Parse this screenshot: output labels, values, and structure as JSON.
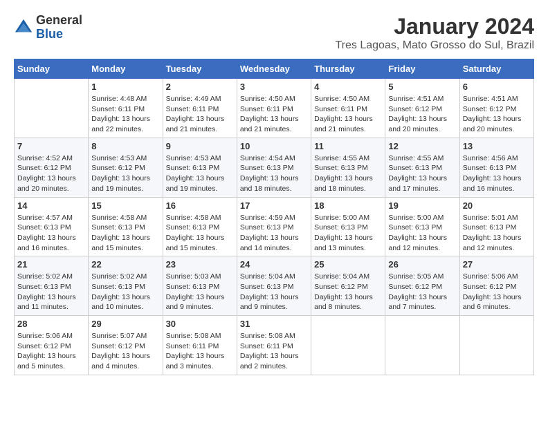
{
  "header": {
    "logo_general": "General",
    "logo_blue": "Blue",
    "month_year": "January 2024",
    "location": "Tres Lagoas, Mato Grosso do Sul, Brazil"
  },
  "weekdays": [
    "Sunday",
    "Monday",
    "Tuesday",
    "Wednesday",
    "Thursday",
    "Friday",
    "Saturday"
  ],
  "weeks": [
    [
      {
        "day": "",
        "sunrise": "",
        "sunset": "",
        "daylight": ""
      },
      {
        "day": "1",
        "sunrise": "Sunrise: 4:48 AM",
        "sunset": "Sunset: 6:11 PM",
        "daylight": "Daylight: 13 hours and 22 minutes."
      },
      {
        "day": "2",
        "sunrise": "Sunrise: 4:49 AM",
        "sunset": "Sunset: 6:11 PM",
        "daylight": "Daylight: 13 hours and 21 minutes."
      },
      {
        "day": "3",
        "sunrise": "Sunrise: 4:50 AM",
        "sunset": "Sunset: 6:11 PM",
        "daylight": "Daylight: 13 hours and 21 minutes."
      },
      {
        "day": "4",
        "sunrise": "Sunrise: 4:50 AM",
        "sunset": "Sunset: 6:11 PM",
        "daylight": "Daylight: 13 hours and 21 minutes."
      },
      {
        "day": "5",
        "sunrise": "Sunrise: 4:51 AM",
        "sunset": "Sunset: 6:12 PM",
        "daylight": "Daylight: 13 hours and 20 minutes."
      },
      {
        "day": "6",
        "sunrise": "Sunrise: 4:51 AM",
        "sunset": "Sunset: 6:12 PM",
        "daylight": "Daylight: 13 hours and 20 minutes."
      }
    ],
    [
      {
        "day": "7",
        "sunrise": "Sunrise: 4:52 AM",
        "sunset": "Sunset: 6:12 PM",
        "daylight": "Daylight: 13 hours and 20 minutes."
      },
      {
        "day": "8",
        "sunrise": "Sunrise: 4:53 AM",
        "sunset": "Sunset: 6:12 PM",
        "daylight": "Daylight: 13 hours and 19 minutes."
      },
      {
        "day": "9",
        "sunrise": "Sunrise: 4:53 AM",
        "sunset": "Sunset: 6:13 PM",
        "daylight": "Daylight: 13 hours and 19 minutes."
      },
      {
        "day": "10",
        "sunrise": "Sunrise: 4:54 AM",
        "sunset": "Sunset: 6:13 PM",
        "daylight": "Daylight: 13 hours and 18 minutes."
      },
      {
        "day": "11",
        "sunrise": "Sunrise: 4:55 AM",
        "sunset": "Sunset: 6:13 PM",
        "daylight": "Daylight: 13 hours and 18 minutes."
      },
      {
        "day": "12",
        "sunrise": "Sunrise: 4:55 AM",
        "sunset": "Sunset: 6:13 PM",
        "daylight": "Daylight: 13 hours and 17 minutes."
      },
      {
        "day": "13",
        "sunrise": "Sunrise: 4:56 AM",
        "sunset": "Sunset: 6:13 PM",
        "daylight": "Daylight: 13 hours and 16 minutes."
      }
    ],
    [
      {
        "day": "14",
        "sunrise": "Sunrise: 4:57 AM",
        "sunset": "Sunset: 6:13 PM",
        "daylight": "Daylight: 13 hours and 16 minutes."
      },
      {
        "day": "15",
        "sunrise": "Sunrise: 4:58 AM",
        "sunset": "Sunset: 6:13 PM",
        "daylight": "Daylight: 13 hours and 15 minutes."
      },
      {
        "day": "16",
        "sunrise": "Sunrise: 4:58 AM",
        "sunset": "Sunset: 6:13 PM",
        "daylight": "Daylight: 13 hours and 15 minutes."
      },
      {
        "day": "17",
        "sunrise": "Sunrise: 4:59 AM",
        "sunset": "Sunset: 6:13 PM",
        "daylight": "Daylight: 13 hours and 14 minutes."
      },
      {
        "day": "18",
        "sunrise": "Sunrise: 5:00 AM",
        "sunset": "Sunset: 6:13 PM",
        "daylight": "Daylight: 13 hours and 13 minutes."
      },
      {
        "day": "19",
        "sunrise": "Sunrise: 5:00 AM",
        "sunset": "Sunset: 6:13 PM",
        "daylight": "Daylight: 13 hours and 12 minutes."
      },
      {
        "day": "20",
        "sunrise": "Sunrise: 5:01 AM",
        "sunset": "Sunset: 6:13 PM",
        "daylight": "Daylight: 13 hours and 12 minutes."
      }
    ],
    [
      {
        "day": "21",
        "sunrise": "Sunrise: 5:02 AM",
        "sunset": "Sunset: 6:13 PM",
        "daylight": "Daylight: 13 hours and 11 minutes."
      },
      {
        "day": "22",
        "sunrise": "Sunrise: 5:02 AM",
        "sunset": "Sunset: 6:13 PM",
        "daylight": "Daylight: 13 hours and 10 minutes."
      },
      {
        "day": "23",
        "sunrise": "Sunrise: 5:03 AM",
        "sunset": "Sunset: 6:13 PM",
        "daylight": "Daylight: 13 hours and 9 minutes."
      },
      {
        "day": "24",
        "sunrise": "Sunrise: 5:04 AM",
        "sunset": "Sunset: 6:13 PM",
        "daylight": "Daylight: 13 hours and 9 minutes."
      },
      {
        "day": "25",
        "sunrise": "Sunrise: 5:04 AM",
        "sunset": "Sunset: 6:12 PM",
        "daylight": "Daylight: 13 hours and 8 minutes."
      },
      {
        "day": "26",
        "sunrise": "Sunrise: 5:05 AM",
        "sunset": "Sunset: 6:12 PM",
        "daylight": "Daylight: 13 hours and 7 minutes."
      },
      {
        "day": "27",
        "sunrise": "Sunrise: 5:06 AM",
        "sunset": "Sunset: 6:12 PM",
        "daylight": "Daylight: 13 hours and 6 minutes."
      }
    ],
    [
      {
        "day": "28",
        "sunrise": "Sunrise: 5:06 AM",
        "sunset": "Sunset: 6:12 PM",
        "daylight": "Daylight: 13 hours and 5 minutes."
      },
      {
        "day": "29",
        "sunrise": "Sunrise: 5:07 AM",
        "sunset": "Sunset: 6:12 PM",
        "daylight": "Daylight: 13 hours and 4 minutes."
      },
      {
        "day": "30",
        "sunrise": "Sunrise: 5:08 AM",
        "sunset": "Sunset: 6:11 PM",
        "daylight": "Daylight: 13 hours and 3 minutes."
      },
      {
        "day": "31",
        "sunrise": "Sunrise: 5:08 AM",
        "sunset": "Sunset: 6:11 PM",
        "daylight": "Daylight: 13 hours and 2 minutes."
      },
      {
        "day": "",
        "sunrise": "",
        "sunset": "",
        "daylight": ""
      },
      {
        "day": "",
        "sunrise": "",
        "sunset": "",
        "daylight": ""
      },
      {
        "day": "",
        "sunrise": "",
        "sunset": "",
        "daylight": ""
      }
    ]
  ]
}
